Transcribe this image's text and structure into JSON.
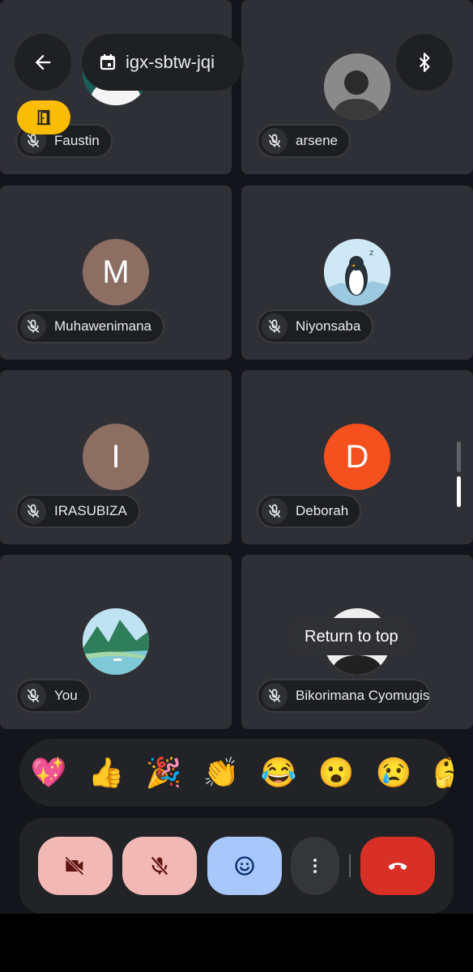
{
  "header": {
    "meeting_code": "igx-sbtw-jqi"
  },
  "participants": [
    {
      "name": "Faustin",
      "avatar": "photo-man-white-shirt",
      "muted": true
    },
    {
      "name": "arsene",
      "avatar": "photo-man-bw",
      "muted": true
    },
    {
      "name": "Muhawenimana",
      "avatar_letter": "M",
      "avatar_color": "#8d6e63",
      "muted": true
    },
    {
      "name": "Niyonsaba",
      "avatar": "penguin-illustration",
      "muted": true
    },
    {
      "name": "IRASUBIZA",
      "avatar_letter": "I",
      "avatar_color": "#8d6e63",
      "muted": true
    },
    {
      "name": "Deborah",
      "avatar_letter": "D",
      "avatar_color": "#f4511e",
      "muted": true
    },
    {
      "name": "You",
      "avatar": "landscape-illustration",
      "muted": true
    },
    {
      "name": "Bikorimana Cyomugis",
      "avatar": "photo-man-dark",
      "muted": true
    }
  ],
  "tooltip": "Return to top",
  "reactions": [
    "💖",
    "👍",
    "🎉",
    "👏",
    "😂",
    "😮",
    "😢",
    "🤔"
  ],
  "controls": {
    "camera": "camera-off-icon",
    "mic": "mic-off-icon",
    "emoji": "emoji-icon",
    "more": "more-vert-icon",
    "end_call": "end-call-icon"
  },
  "colors": {
    "background": "#13151a",
    "tile": "#2f3035",
    "control_off": "#f2b8b5",
    "emoji_active": "#a8c7fa",
    "end_call": "#d93025",
    "room_badge": "#fbbc04"
  }
}
